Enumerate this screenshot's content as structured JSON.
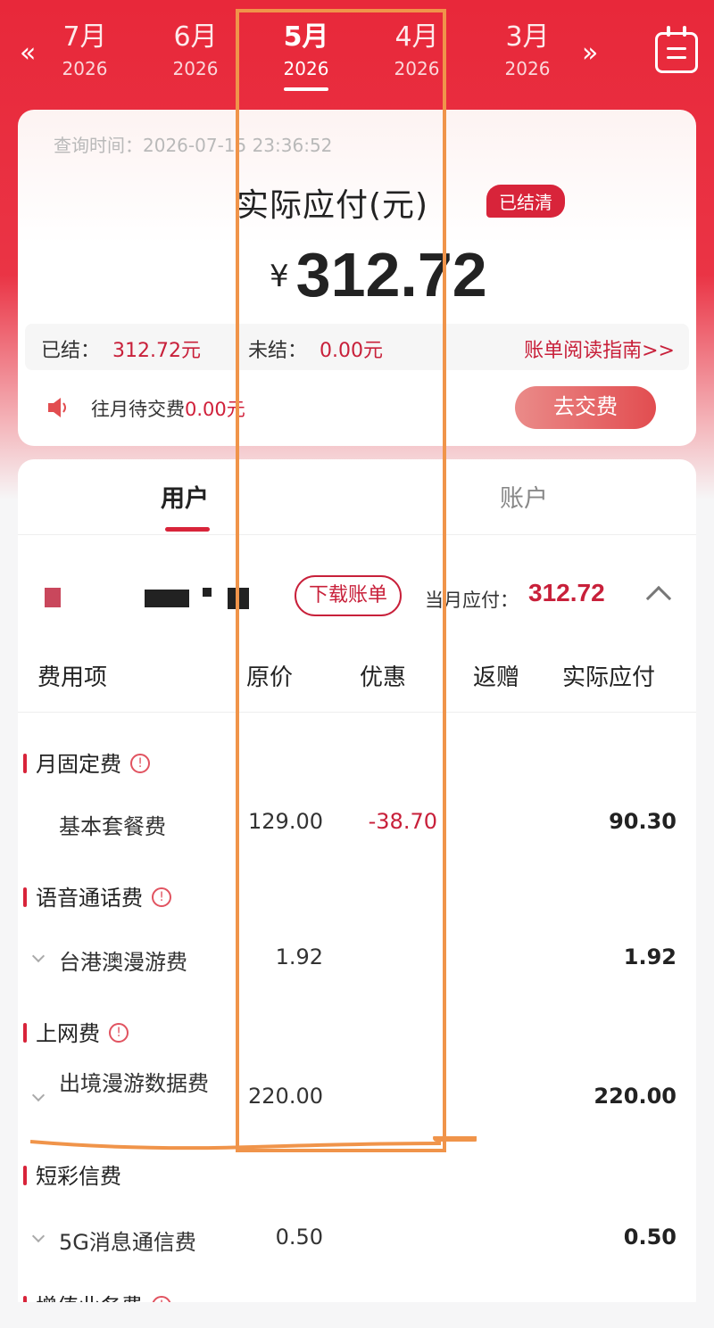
{
  "months": [
    {
      "month": "7月",
      "year": "2026",
      "active": false
    },
    {
      "month": "6月",
      "year": "2026",
      "active": false
    },
    {
      "month": "5月",
      "year": "2026",
      "active": true
    },
    {
      "month": "4月",
      "year": "2026",
      "active": false
    },
    {
      "month": "3月",
      "year": "2026",
      "active": false
    }
  ],
  "nav": {
    "prev_arrow": "«",
    "next_arrow": "»"
  },
  "summary": {
    "query_time": "查询时间：2026-07-15 23:36:52",
    "title": "实际应付(元)",
    "status_badge": "已结清",
    "currency": "¥",
    "amount": "312.72",
    "settled_label": "已结：",
    "settled_value": "312.72元",
    "unsettled_label": "未结：",
    "unsettled_value": "0.00元",
    "guide_link": "账单阅读指南>>",
    "prev_due_label": "往月待交费",
    "prev_due_value": "0.00元",
    "pay_button": "去交费"
  },
  "tabs": {
    "user": "用户",
    "account": "账户"
  },
  "user_row": {
    "download_button": "下载账单",
    "month_due_label": "当月应付：",
    "month_due_value": "312.72"
  },
  "table": {
    "headers": [
      "费用项",
      "原价",
      "优惠",
      "返赠",
      "实际应付"
    ],
    "sections": [
      {
        "category": "月固定费",
        "items": [
          {
            "name": "基本套餐费",
            "original": "129.00",
            "discount": "-38.70",
            "actual": "90.30",
            "expandable": false
          }
        ]
      },
      {
        "category": "语音通话费",
        "items": [
          {
            "name": "台港澳漫游费",
            "original": "1.92",
            "discount": "",
            "actual": "1.92",
            "expandable": true
          }
        ]
      },
      {
        "category": "上网费",
        "items": [
          {
            "name": "出境漫游数据费",
            "original": "220.00",
            "discount": "",
            "actual": "220.00",
            "expandable": true
          }
        ]
      },
      {
        "category": "短彩信费",
        "items": [
          {
            "name": "5G消息通信费",
            "original": "0.50",
            "discount": "",
            "actual": "0.50",
            "expandable": true
          }
        ]
      },
      {
        "category": "增值业务费",
        "items": []
      }
    ]
  },
  "colors": {
    "brand_red": "#e8283a",
    "accent_red": "#c8203a",
    "annotation_orange": "#f0944a"
  }
}
